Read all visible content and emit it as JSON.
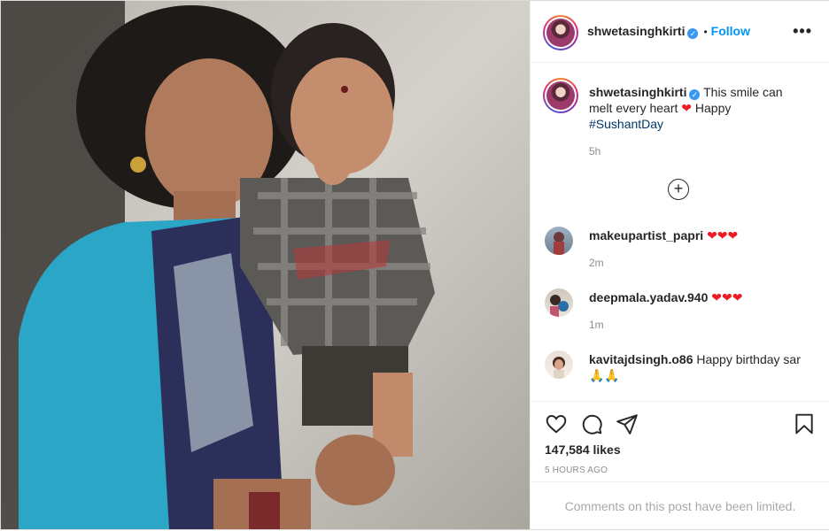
{
  "header": {
    "username": "shwetasinghkirti",
    "separator": "•",
    "follow_label": "Follow",
    "more_label": "•••"
  },
  "caption": {
    "username": "shwetasinghkirti",
    "text_before_heart": "This smile can melt every heart",
    "heart": "❤",
    "text_after_heart": "Happy",
    "hashtag": "#SushantDay",
    "time": "5h"
  },
  "load_more": {
    "icon": "plus-circle-icon"
  },
  "comments": [
    {
      "username": "makeupartist_papri",
      "text": "❤❤❤",
      "time": "2m"
    },
    {
      "username": "deepmala.yadav.940",
      "text": "❤❤❤",
      "time": "1m"
    },
    {
      "username": "kavitajdsingh.o86",
      "text": "Happy birthday sar",
      "emoji": "🙏🙏"
    }
  ],
  "engagement": {
    "likes": "147,584 likes",
    "posted": "5 HOURS AGO",
    "comments_limited": "Comments on this post have been limited."
  },
  "colors": {
    "link_blue": "#0095f6",
    "verified_blue": "#3897f0",
    "hashtag": "#00376b",
    "heart_red": "#ed1c24",
    "muted": "#8e8e8e",
    "border": "#efefef"
  },
  "icons": [
    "heart-outline-icon",
    "comment-icon",
    "share-icon",
    "bookmark-icon",
    "verified-badge-icon"
  ]
}
